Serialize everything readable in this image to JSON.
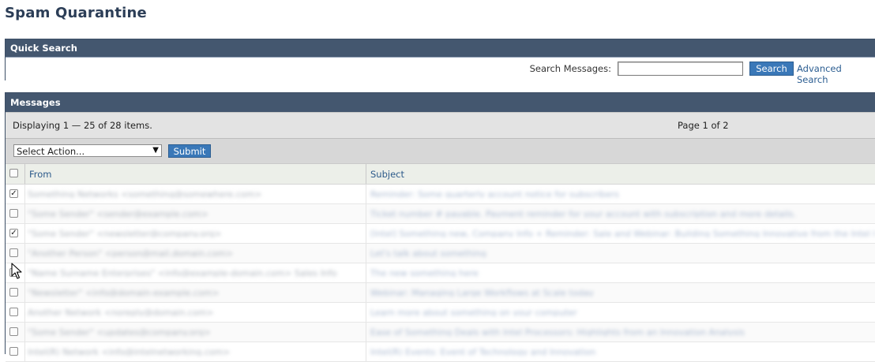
{
  "page": {
    "title": "Spam Quarantine"
  },
  "quick_search": {
    "header": "Quick Search",
    "label": "Search Messages:",
    "input_value": "",
    "search_button": "Search",
    "advanced_link": "Advanced Search"
  },
  "messages": {
    "header": "Messages",
    "displaying": "Displaying 1 — 25 of 28 items.",
    "page_info": "Page 1 of 2",
    "action_select": "Select Action...",
    "submit_button": "Submit",
    "columns": {
      "from": "From",
      "subject": "Subject"
    },
    "rows": [
      {
        "checked": true,
        "from": "Something Networks <something@somewhere.com>",
        "subject": "Reminder: Some quarterly account notice for subscribers"
      },
      {
        "checked": false,
        "from": "\"Some Sender\" <sender@example.com>",
        "subject": "Ticket number # payable. Payment reminder for your account with subscription and more details."
      },
      {
        "checked": true,
        "from": "\"Some Sender\" <newsletter@company.org>",
        "subject": "[Intel] Something new, Company Info + Reminder: Sale and Webinar: Building Something Innovative from the Intel Innovation event"
      },
      {
        "checked": false,
        "from": "\"Another Person\" <person@mail.domain.com>",
        "subject": "Let's talk about something"
      },
      {
        "checked": true,
        "from": "\"Name Surname Enterprises\" <info@example-domain.com> Sales Info",
        "subject": "The new something here"
      },
      {
        "checked": false,
        "from": "\"Newsletter\" <info@domain-example.com>",
        "subject": "Webinar: Managing Large Workflows at Scale today"
      },
      {
        "checked": false,
        "from": "Another Network <noreply@domain.com>",
        "subject": "Learn more about something on your computer"
      },
      {
        "checked": false,
        "from": "\"Some Sender\" <updates@company.org>",
        "subject": "Ease of Something Deals with Intel Processors: Highlights from an Innovation Analysis"
      },
      {
        "checked": false,
        "from": "Intel(R) Network <info@intelnetworking.com>",
        "subject": "Intel(R) Events: Event of Technology and Innovation"
      }
    ]
  }
}
